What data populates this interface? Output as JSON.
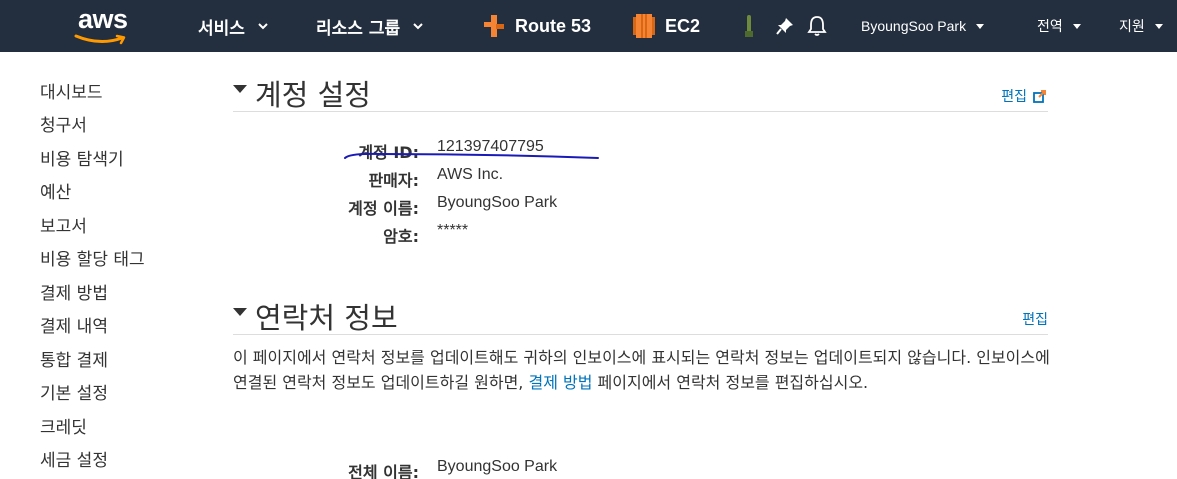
{
  "header": {
    "logo_text": "aws",
    "services_label": "서비스",
    "resource_groups_label": "리소스 그룹",
    "shortcuts": [
      {
        "label": "Route 53",
        "icon": "route53-icon",
        "color": "#f58534"
      },
      {
        "label": "EC2",
        "icon": "ec2-icon",
        "color": "#f58534"
      }
    ],
    "user_label": "ByoungSoo Park",
    "region_label": "전역",
    "support_label": "지원",
    "colors": {
      "bg": "#232f3e",
      "logo_smile": "#ff9900"
    }
  },
  "sidebar": {
    "items": [
      {
        "label": "대시보드"
      },
      {
        "label": "청구서"
      },
      {
        "label": "비용 탐색기"
      },
      {
        "label": "예산"
      },
      {
        "label": "보고서"
      },
      {
        "label": "비용 할당 태그"
      },
      {
        "label": "결제 방법"
      },
      {
        "label": "결제 내역"
      },
      {
        "label": "통합 결제"
      },
      {
        "label": "기본 설정"
      },
      {
        "label": "크레딧"
      },
      {
        "label": "세금 설정"
      }
    ]
  },
  "account_settings": {
    "title": "계정 설정",
    "edit_label": "편집",
    "fields": [
      {
        "label": "계정 ID:",
        "value": "121397407795"
      },
      {
        "label": "판매자:",
        "value": "AWS Inc."
      },
      {
        "label": "계정 이름:",
        "value": "ByoungSoo Park"
      },
      {
        "label": "암호:",
        "value": "*****"
      }
    ]
  },
  "contact_info": {
    "title": "연락처 정보",
    "edit_label": "편집",
    "description_before": "이 페이지에서 연락처 정보를 업데이트해도 귀하의 인보이스에 표시되는 연락처 정보는 업데이트되지 않습니다. 인보이스에 연결된 연락처 정보도 업데이트하길 원하면, ",
    "description_link": "결제 방법",
    "description_after": " 페이지에서 연락처 정보를 편집하십시오.",
    "fields": [
      {
        "label": "전체 이름:",
        "value": "ByoungSoo Park"
      }
    ]
  },
  "colors": {
    "link": "#0073bb",
    "text": "#333333",
    "annotation": "#1a1ab8"
  }
}
